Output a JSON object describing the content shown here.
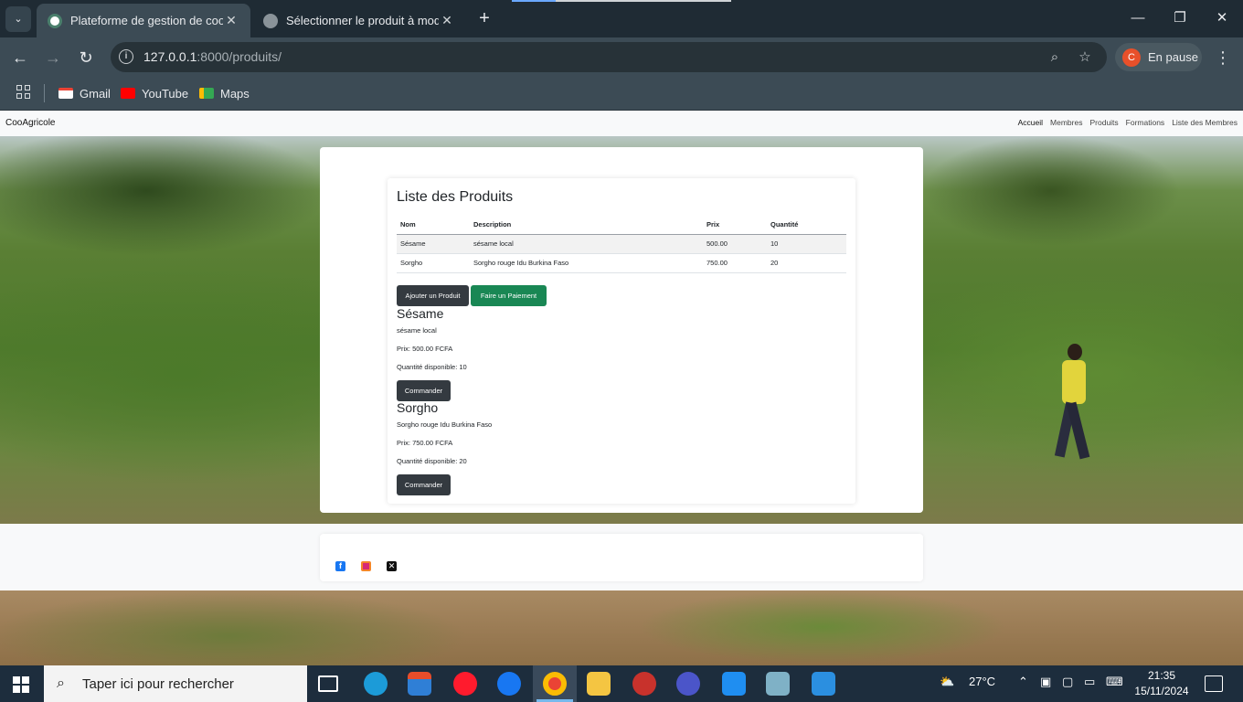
{
  "browser": {
    "tabs": [
      {
        "title": "Plateforme de gestion de coopé",
        "active": true
      },
      {
        "title": "Sélectionner le produit à modifi",
        "active": false
      }
    ],
    "address": {
      "host": "127.0.0.1",
      "path": ":8000/produits/"
    },
    "profile": {
      "initial": "C",
      "label": "En pause"
    },
    "bookmarks": [
      "Gmail",
      "YouTube",
      "Maps"
    ]
  },
  "site": {
    "brand": "CooAgricole",
    "nav": [
      "Accueil",
      "Membres",
      "Produits",
      "Formations",
      "Liste des Membres"
    ]
  },
  "products_page": {
    "title": "Liste des Produits",
    "columns": [
      "Nom",
      "Description",
      "Prix",
      "Quantité"
    ],
    "rows": [
      {
        "nom": "Sésame",
        "description": "sésame local",
        "prix": "500.00",
        "quantite": "10"
      },
      {
        "nom": "Sorgho",
        "description": "Sorgho rouge Idu Burkina Faso",
        "prix": "750.00",
        "quantite": "20"
      }
    ],
    "add_button": "Ajouter un Produit",
    "pay_button": "Faire un Paiement",
    "cards": [
      {
        "name": "Sésame",
        "description": "sésame local",
        "price": "Prix: 500.00 FCFA",
        "stock": "Quantité disponible: 10",
        "order_button": "Commander"
      },
      {
        "name": "Sorgho",
        "description": "Sorgho rouge Idu Burkina Faso",
        "price": "Prix: 750.00 FCFA",
        "stock": "Quantité disponible: 20",
        "order_button": "Commander"
      }
    ]
  },
  "footer": {
    "social": [
      "facebook-icon",
      "instagram-icon",
      "x-icon"
    ]
  },
  "taskbar": {
    "search_placeholder": "Taper ici pour rechercher",
    "weather": "27°C",
    "time": "21:35",
    "date": "15/11/2024"
  }
}
